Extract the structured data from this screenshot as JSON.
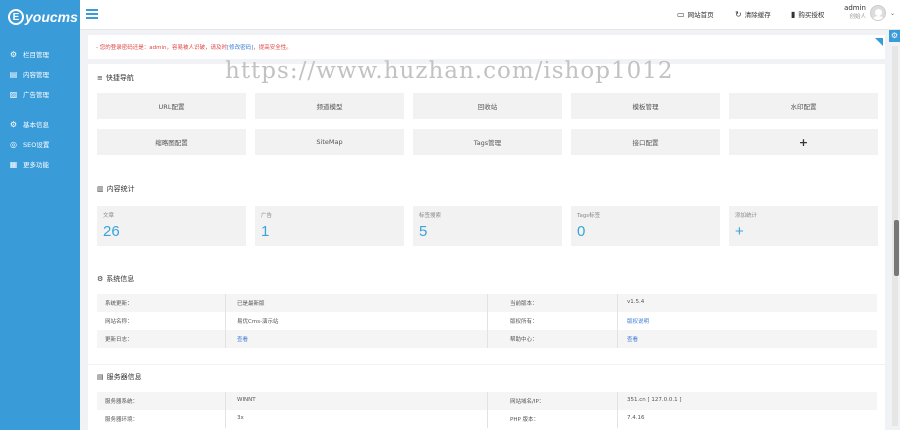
{
  "brand": {
    "logo_letter": "E",
    "logo_text": "youcms",
    "accent": "#3a9bd9"
  },
  "sidebar": {
    "items": [
      {
        "icon": "gear-icon",
        "label": "栏目管理"
      },
      {
        "icon": "document-icon",
        "label": "内容管理"
      },
      {
        "icon": "image-icon",
        "label": "广告管理"
      },
      {
        "icon": "settings-icon",
        "label": "基本信息"
      },
      {
        "icon": "seo-icon",
        "label": "SEO设置"
      },
      {
        "icon": "apps-icon",
        "label": "更多功能"
      }
    ]
  },
  "header": {
    "links": [
      {
        "icon": "monitor-icon",
        "label": "网站首页"
      },
      {
        "icon": "refresh-icon",
        "label": "清除缓存"
      },
      {
        "icon": "bookmark-icon",
        "label": "购买授权"
      }
    ],
    "admin_name": "admin",
    "admin_role": "创始人"
  },
  "notice": {
    "prefix": "- 您的登录密码还是：admin，容易被人识破，请及时",
    "link": "[修改密码]",
    "suffix": "，提高安全性。"
  },
  "quick_nav": {
    "title": "快捷导航",
    "buttons": [
      "URL配置",
      "频道模型",
      "回收站",
      "模板管理",
      "水印配置",
      "缩略图配置",
      "SiteMap",
      "Tags管理",
      "接口配置",
      "+"
    ]
  },
  "stats": {
    "title": "内容统计",
    "items": [
      {
        "label": "文章",
        "value": "26"
      },
      {
        "label": "广告",
        "value": "1"
      },
      {
        "label": "标签搜索",
        "value": "5"
      },
      {
        "label": "Tags标签",
        "value": "0"
      },
      {
        "label": "添加统计",
        "value": "+"
      }
    ]
  },
  "system_info": {
    "title": "系统信息",
    "rows": [
      {
        "k1": "系统更新：",
        "v1": "已是最新版",
        "k2": "当前版本：",
        "v2": "v1.5.4"
      },
      {
        "k1": "网站名称：",
        "v1": "易优Cms-演示站",
        "k2": "版权所有：",
        "v2": "版权说明"
      },
      {
        "k1": "更新日志：",
        "v1": "查看",
        "k2": "帮助中心：",
        "v2": "查看"
      }
    ]
  },
  "server_info": {
    "title": "服务器信息",
    "rows": [
      {
        "k1": "服务器系统：",
        "v1": "WINNT",
        "k2": "网站域名/IP：",
        "v2": "351.cn [ 127.0.0.1 ]"
      },
      {
        "k1": "服务器环境：",
        "v1": "3x",
        "k2": "PHP 版本：",
        "v2": "7.4.16"
      }
    ]
  },
  "watermark": "https://www.huzhan.com/ishop1012"
}
